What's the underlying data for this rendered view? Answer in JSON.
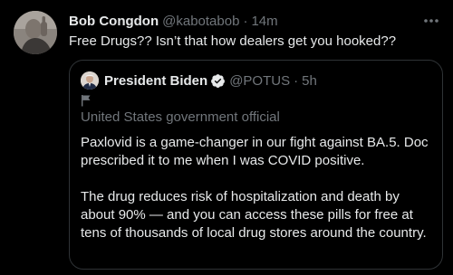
{
  "tweet": {
    "display_name": "Bob Congdon",
    "handle": "@kabotabob",
    "separator": "·",
    "time": "14m",
    "text": "Free Drugs?? Isn’t that how dealers get you hooked??"
  },
  "quoted_tweet": {
    "display_name": "President Biden",
    "handle": "@POTUS",
    "separator": "·",
    "time": "5h",
    "account_label": "United States government official",
    "paragraphs": [
      "Paxlovid is a game-changer in our fight against BA.5. Doc prescribed it to me when I was COVID positive.",
      "The drug reduces risk of hospitalization and death by about 90% — and you can access these pills for free at tens of thousands of local drug stores around the country."
    ]
  },
  "icons": {
    "more": "more-dots-icon",
    "verified": "verified-badge-icon",
    "flag": "government-flag-icon"
  },
  "colors": {
    "background": "#000000",
    "text_primary": "#e7e9ea",
    "text_secondary": "#71767b",
    "border": "#2f3336"
  }
}
